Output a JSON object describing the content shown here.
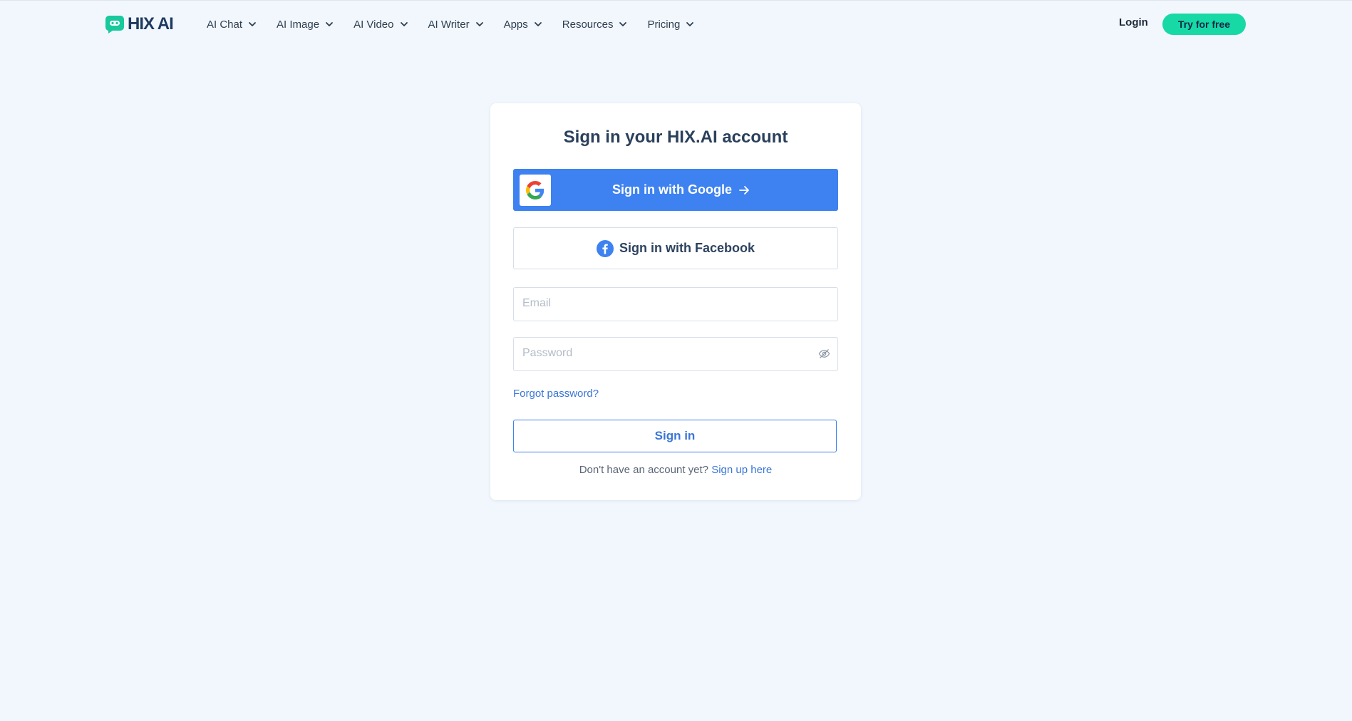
{
  "brand": {
    "name": "HIX AI",
    "accent": "#17d9a6",
    "primary": "#3d82f0"
  },
  "nav": {
    "items": [
      {
        "label": "AI Chat"
      },
      {
        "label": "AI Image"
      },
      {
        "label": "AI Video"
      },
      {
        "label": "AI Writer"
      },
      {
        "label": "Apps"
      },
      {
        "label": "Resources"
      },
      {
        "label": "Pricing"
      }
    ],
    "login_label": "Login",
    "try_label": "Try for free"
  },
  "signin": {
    "title": "Sign in your HIX.AI account",
    "google_label": "Sign in with Google",
    "facebook_label": "Sign in with Facebook",
    "email_placeholder": "Email",
    "password_placeholder": "Password",
    "forgot_label": "Forgot password?",
    "submit_label": "Sign in",
    "no_account_text": "Don't have an account yet?",
    "signup_label": "Sign up here"
  },
  "icons": {
    "logo": "hix-logo-icon",
    "chevron": "chevron-down-icon",
    "google": "google-icon",
    "arrow": "arrow-right-icon",
    "facebook": "facebook-icon",
    "eye": "eye-off-icon"
  }
}
